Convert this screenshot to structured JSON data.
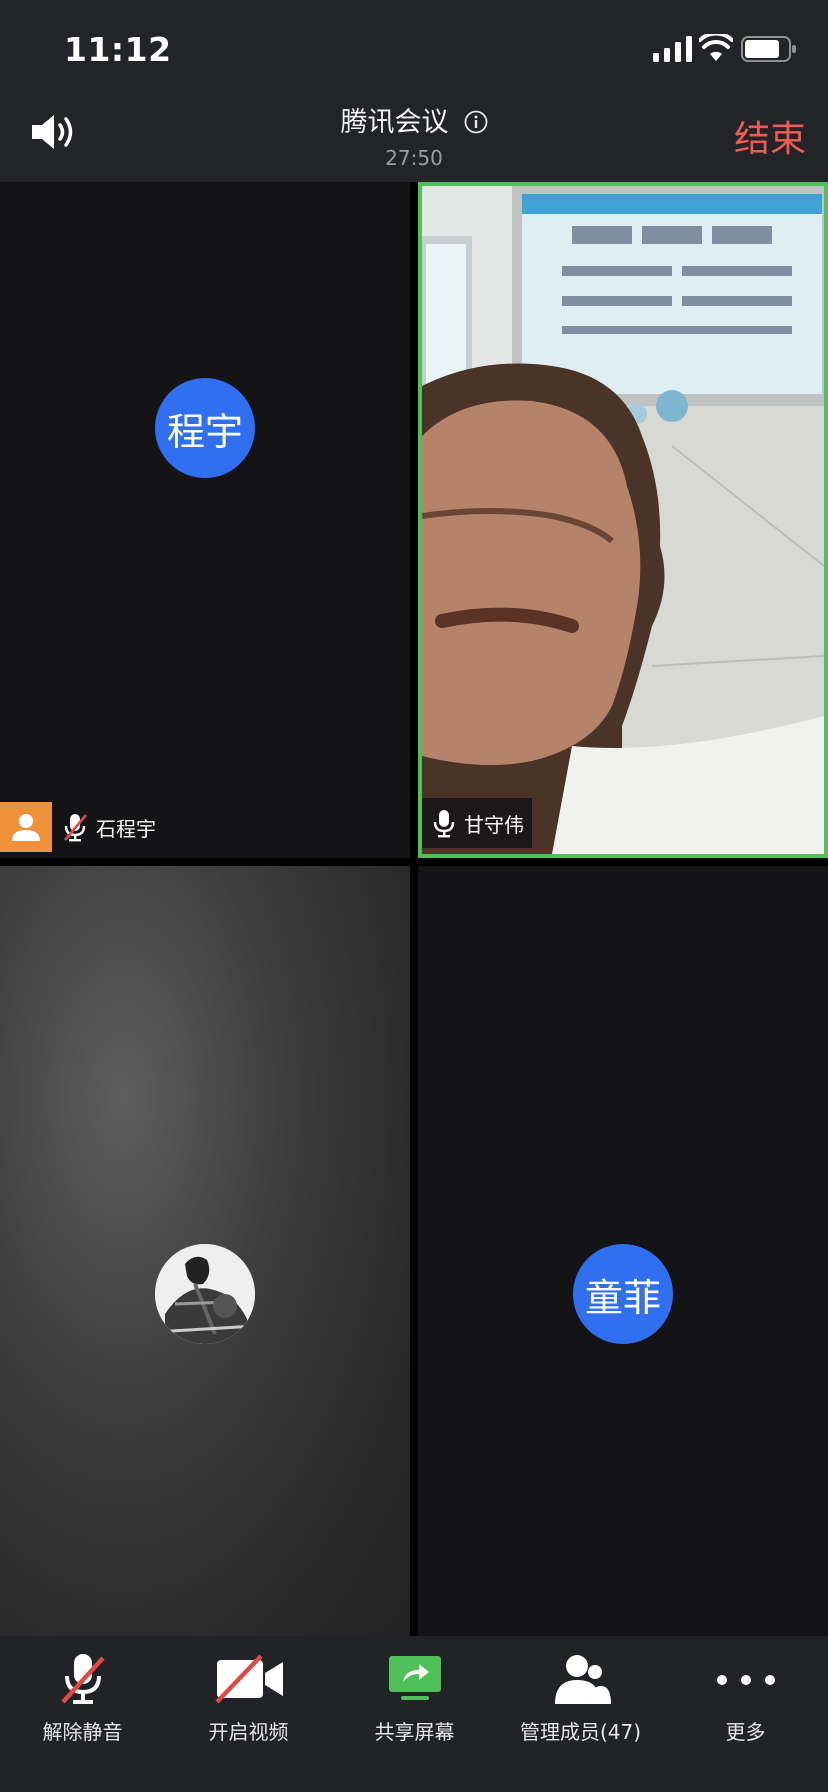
{
  "status_bar": {
    "time": "11:12"
  },
  "header": {
    "title": "腾讯会议",
    "elapsed": "27:50",
    "end_label": "结束"
  },
  "participants": [
    {
      "avatar_text": "程宇",
      "name": "石程宇",
      "muted": true,
      "is_host": true
    },
    {
      "name": "甘守伟",
      "muted": false,
      "video_on": true,
      "active_speaker": true
    },
    {
      "avatar": "photo"
    },
    {
      "avatar_text": "童菲"
    }
  ],
  "toolbar": {
    "unmute": "解除静音",
    "video": "开启视频",
    "share": "共享屏幕",
    "members": "管理成员(47)",
    "more": "更多"
  },
  "colors": {
    "accent_blue": "#2f6ff0",
    "end_red": "#ec5b56",
    "speaker_green": "#4fc058",
    "host_orange": "#f0913a"
  }
}
